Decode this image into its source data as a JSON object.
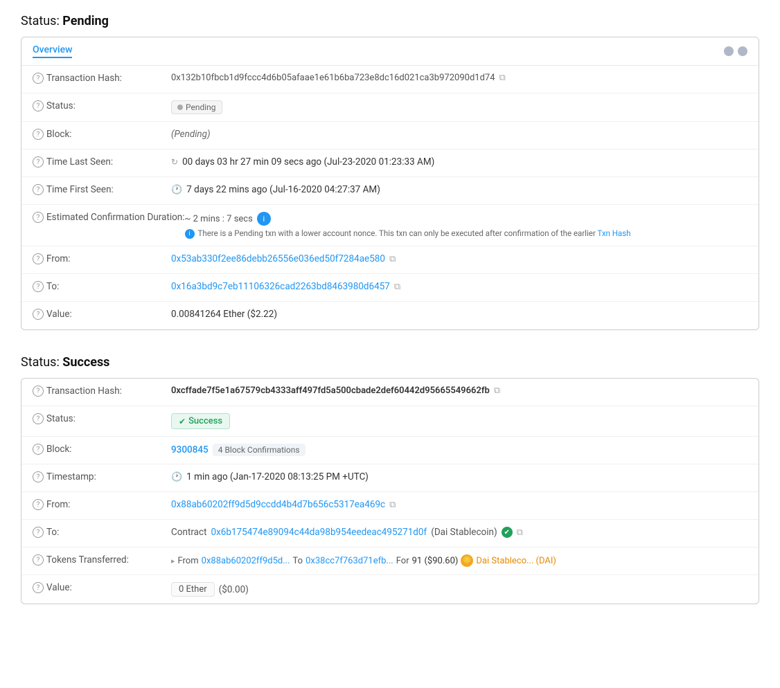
{
  "pending_section": {
    "title": "Status:",
    "title_bold": "Pending",
    "tab": {
      "label": "Overview",
      "dot1": true,
      "dot2": true
    },
    "rows": [
      {
        "id": "tx-hash",
        "label": "Transaction Hash:",
        "value": "0x132b10fbcb1d9fccc4d6b05afaae1e61b6ba723e8dc16d021ca3b972090d1d74",
        "has_copy": true
      },
      {
        "id": "status",
        "label": "Status:",
        "badge": "pending",
        "badge_text": "Pending"
      },
      {
        "id": "block",
        "label": "Block:",
        "value": "(Pending)",
        "italic": true
      },
      {
        "id": "time-last-seen",
        "label": "Time Last Seen:",
        "icon": "spinner",
        "value": "00 days 03 hr 27 min 09 secs ago (Jul-23-2020 01:23:33 AM)"
      },
      {
        "id": "time-first-seen",
        "label": "Time First Seen:",
        "icon": "clock",
        "value": "7 days 22 mins ago (Jul-16-2020 04:27:37 AM)"
      },
      {
        "id": "est-confirmation",
        "label": "Estimated Confirmation Duration:",
        "estimate": "~ 2 mins : 7 secs",
        "warning": "There is a Pending txn with a lower account nonce. This txn can only be executed after confirmation of the earlier",
        "warning_link": "Txn Hash"
      },
      {
        "id": "from",
        "label": "From:",
        "value": "0x53ab330f2ee86debb26556e036ed50f7284ae580",
        "is_link": true,
        "has_copy": true
      },
      {
        "id": "to",
        "label": "To:",
        "value": "0x16a3bd9c7eb11106326cad2263bd8463980d6457",
        "is_link": true,
        "has_copy": true
      },
      {
        "id": "value",
        "label": "Value:",
        "value": "0.00841264 Ether ($2.22)"
      }
    ]
  },
  "success_section": {
    "title": "Status:",
    "title_bold": "Success",
    "rows": [
      {
        "id": "tx-hash",
        "label": "Transaction Hash:",
        "value": "0xcffade7f5e1a67579cb4333aff497fd5a500cbade2def60442d95665549662fb",
        "bold": true,
        "has_copy": true
      },
      {
        "id": "status",
        "label": "Status:",
        "badge": "success",
        "badge_text": "Success"
      },
      {
        "id": "block",
        "label": "Block:",
        "block_num": "9300845",
        "confirmations": "4 Block Confirmations"
      },
      {
        "id": "timestamp",
        "label": "Timestamp:",
        "icon": "clock",
        "value": "1 min ago (Jan-17-2020 08:13:25 PM +UTC)"
      },
      {
        "id": "from",
        "label": "From:",
        "value": "0x88ab60202ff9d5d9ccdd4b4d7b656c5317ea469c",
        "is_link": true,
        "has_copy": true
      },
      {
        "id": "to",
        "label": "To:",
        "contract_prefix": "Contract",
        "value": "0x6b175474e89094c44da98b954eedeac495271d0f",
        "contract_name": "(Dai Stablecoin)",
        "is_link": true,
        "verified": true,
        "has_copy": true
      },
      {
        "id": "tokens-transferred",
        "label": "Tokens Transferred:",
        "from_addr": "0x88ab60202ff9d5d...",
        "to_addr": "0x38cc7f763d71efb...",
        "amount": "91 ($90.60)",
        "token_name": "Dai Stableco... (DAI)"
      },
      {
        "id": "value",
        "label": "Value:",
        "value_box": "0 Ether",
        "value_usd": "($0.00)"
      }
    ]
  },
  "icons": {
    "question": "?",
    "copy": "⧉",
    "clock": "🕐",
    "spinner": "↻",
    "check": "✔",
    "arrow_right": "▸",
    "info": "i"
  }
}
